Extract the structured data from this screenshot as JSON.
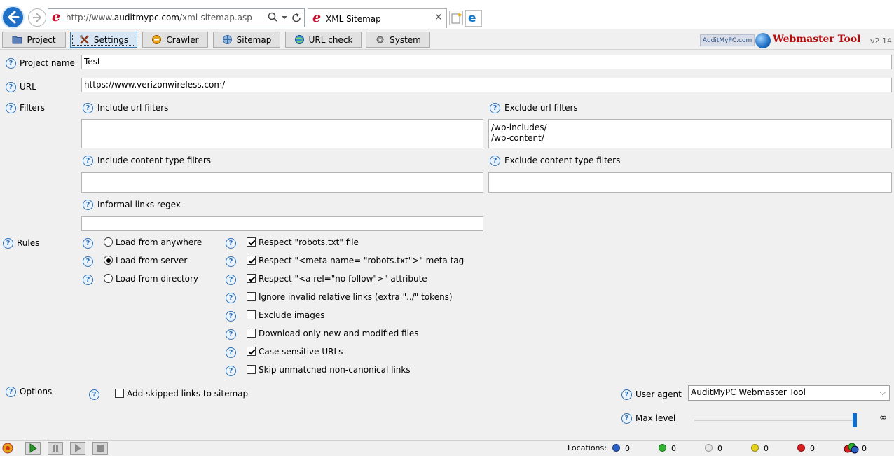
{
  "browser": {
    "url_prefix": "http://www.",
    "url_domain": "auditmypc.com",
    "url_path": "/xml-sitemap.asp",
    "tab_title": "XML Sitemap"
  },
  "toolbar": {
    "tabs": [
      {
        "label": "Project",
        "icon": "folder-icon"
      },
      {
        "label": "Settings",
        "icon": "tools-icon"
      },
      {
        "label": "Crawler",
        "icon": "crawler-icon"
      },
      {
        "label": "Sitemap",
        "icon": "sitemap-icon"
      },
      {
        "label": "URL check",
        "icon": "globe-icon"
      },
      {
        "label": "System",
        "icon": "system-icon"
      }
    ],
    "brand_small": "AuditMyPC.com",
    "brand_title": "Webmaster Tool",
    "version": "v2.14"
  },
  "form": {
    "project_name_label": "Project name",
    "project_name_value": "Test",
    "url_label": "URL",
    "url_value": "https://www.verizonwireless.com/",
    "filters_label": "Filters",
    "include_url_label": "Include url filters",
    "include_url_value": "",
    "exclude_url_label": "Exclude url filters",
    "exclude_url_value": "/wp-includes/\n/wp-content/",
    "include_ct_label": "Include content type filters",
    "include_ct_value": "",
    "exclude_ct_label": "Exclude content type filters",
    "exclude_ct_value": "",
    "informal_label": "Informal links regex",
    "informal_value": "",
    "rules_label": "Rules",
    "load_options": [
      {
        "label": "Load from anywhere",
        "selected": false
      },
      {
        "label": "Load from server",
        "selected": true
      },
      {
        "label": "Load from directory",
        "selected": false
      }
    ],
    "rule_checks": [
      {
        "label": "Respect \"robots.txt\" file",
        "checked": true
      },
      {
        "label": "Respect \"<meta name= \"robots.txt\">\" meta tag",
        "checked": true
      },
      {
        "label": "Respect \"<a rel=\"no follow\">\" attribute",
        "checked": true
      },
      {
        "label": "Ignore invalid relative links (extra \"../\" tokens)",
        "checked": false
      },
      {
        "label": "Exclude images",
        "checked": false
      },
      {
        "label": "Download only new and modified files",
        "checked": false
      },
      {
        "label": "Case sensitive URLs",
        "checked": true
      },
      {
        "label": "Skip unmatched non-canonical links",
        "checked": false
      }
    ],
    "options_label": "Options",
    "add_skipped_label": "Add skipped links to sitemap",
    "add_skipped_checked": false,
    "user_agent_label": "User agent",
    "user_agent_value": "AuditMyPC Webmaster Tool",
    "max_level_label": "Max level",
    "max_level_value": "∞"
  },
  "status": {
    "locations_label": "Locations:",
    "counters": [
      {
        "color": "#2a5fc4",
        "value": "0"
      },
      {
        "color": "#2fb52f",
        "value": "0"
      },
      {
        "color": "#e8e8e8",
        "value": "0"
      },
      {
        "color": "#e6d21e",
        "value": "0"
      },
      {
        "color": "#d92020",
        "value": "0"
      },
      {
        "color": "#7a9a3a",
        "value": "0"
      }
    ]
  }
}
